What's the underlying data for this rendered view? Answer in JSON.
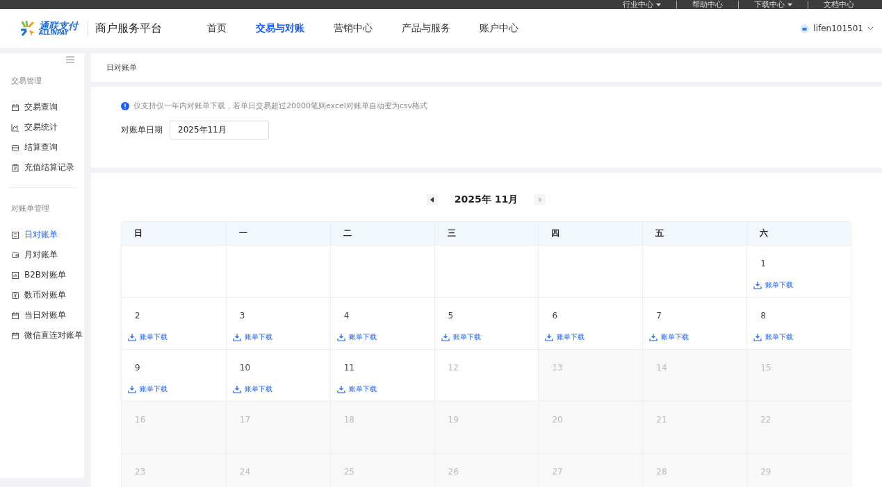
{
  "top_links": [
    {
      "label": "行业中心",
      "caret": true
    },
    {
      "label": "帮助中心",
      "caret": false
    },
    {
      "label": "下载中心",
      "caret": true
    },
    {
      "label": "文档中心",
      "caret": false
    }
  ],
  "header": {
    "logo_cn": "通联支付",
    "logo_en": "ALLINPAY",
    "platform": "商户服务平台",
    "user": "lifen101501"
  },
  "nav": [
    {
      "label": "首页",
      "selected": false
    },
    {
      "label": "交易与对账",
      "selected": true
    },
    {
      "label": "营销中心",
      "selected": false
    },
    {
      "label": "产品与服务",
      "selected": false
    },
    {
      "label": "账户中心",
      "selected": false
    }
  ],
  "sidebar": {
    "groups": [
      {
        "title": "交易管理",
        "items": [
          {
            "label": "交易查询",
            "selected": false
          },
          {
            "label": "交易统计",
            "selected": false
          },
          {
            "label": "结算查询",
            "selected": false
          },
          {
            "label": "充值结算记录",
            "selected": false
          }
        ]
      },
      {
        "title": "对账单管理",
        "items": [
          {
            "label": "日对账单",
            "selected": true
          },
          {
            "label": "月对账单",
            "selected": false
          },
          {
            "label": "B2B对账单",
            "selected": false
          },
          {
            "label": "数币对账单",
            "selected": false
          },
          {
            "label": "当日对账单",
            "selected": false
          },
          {
            "label": "微信直连对账单",
            "selected": false
          }
        ]
      }
    ]
  },
  "breadcrumb": "日对账单",
  "notice": "仅支持仅一年内对账单下载，若单日交易超过20000笔则excel对账单自动变为csv格式",
  "filter": {
    "label": "对账单日期",
    "value": "2025年11月"
  },
  "calendar": {
    "title": "2025年 11月",
    "next_disabled": true,
    "weekdays": [
      "日",
      "一",
      "二",
      "三",
      "四",
      "五",
      "六"
    ],
    "weeks": [
      [
        {
          "kind": "empty"
        },
        {
          "kind": "empty"
        },
        {
          "kind": "empty"
        },
        {
          "kind": "empty"
        },
        {
          "kind": "empty"
        },
        {
          "kind": "empty"
        },
        {
          "kind": "download",
          "day": "1",
          "link": "账单下载"
        }
      ],
      [
        {
          "kind": "download",
          "day": "2",
          "link": "账单下载"
        },
        {
          "kind": "download",
          "day": "3",
          "link": "账单下载"
        },
        {
          "kind": "download",
          "day": "4",
          "link": "账单下载"
        },
        {
          "kind": "download",
          "day": "5",
          "link": "账单下载"
        },
        {
          "kind": "download",
          "day": "6",
          "link": "账单下载"
        },
        {
          "kind": "download",
          "day": "7",
          "link": "账单下载"
        },
        {
          "kind": "download",
          "day": "8",
          "link": "账单下载"
        }
      ],
      [
        {
          "kind": "download",
          "day": "9",
          "link": "账单下载"
        },
        {
          "kind": "download",
          "day": "10",
          "link": "账单下载"
        },
        {
          "kind": "download",
          "day": "11",
          "link": "账单下载"
        },
        {
          "kind": "today",
          "day": "12"
        },
        {
          "kind": "future",
          "day": "13"
        },
        {
          "kind": "future",
          "day": "14"
        },
        {
          "kind": "future",
          "day": "15"
        }
      ],
      [
        {
          "kind": "future",
          "day": "16"
        },
        {
          "kind": "future",
          "day": "17"
        },
        {
          "kind": "future",
          "day": "18"
        },
        {
          "kind": "future",
          "day": "19"
        },
        {
          "kind": "future",
          "day": "20"
        },
        {
          "kind": "future",
          "day": "21"
        },
        {
          "kind": "future",
          "day": "22"
        }
      ],
      [
        {
          "kind": "future",
          "day": "23"
        },
        {
          "kind": "future",
          "day": "24"
        },
        {
          "kind": "future",
          "day": "25"
        },
        {
          "kind": "future",
          "day": "26"
        },
        {
          "kind": "future",
          "day": "27"
        },
        {
          "kind": "future",
          "day": "28"
        },
        {
          "kind": "future",
          "day": "29"
        }
      ]
    ]
  }
}
